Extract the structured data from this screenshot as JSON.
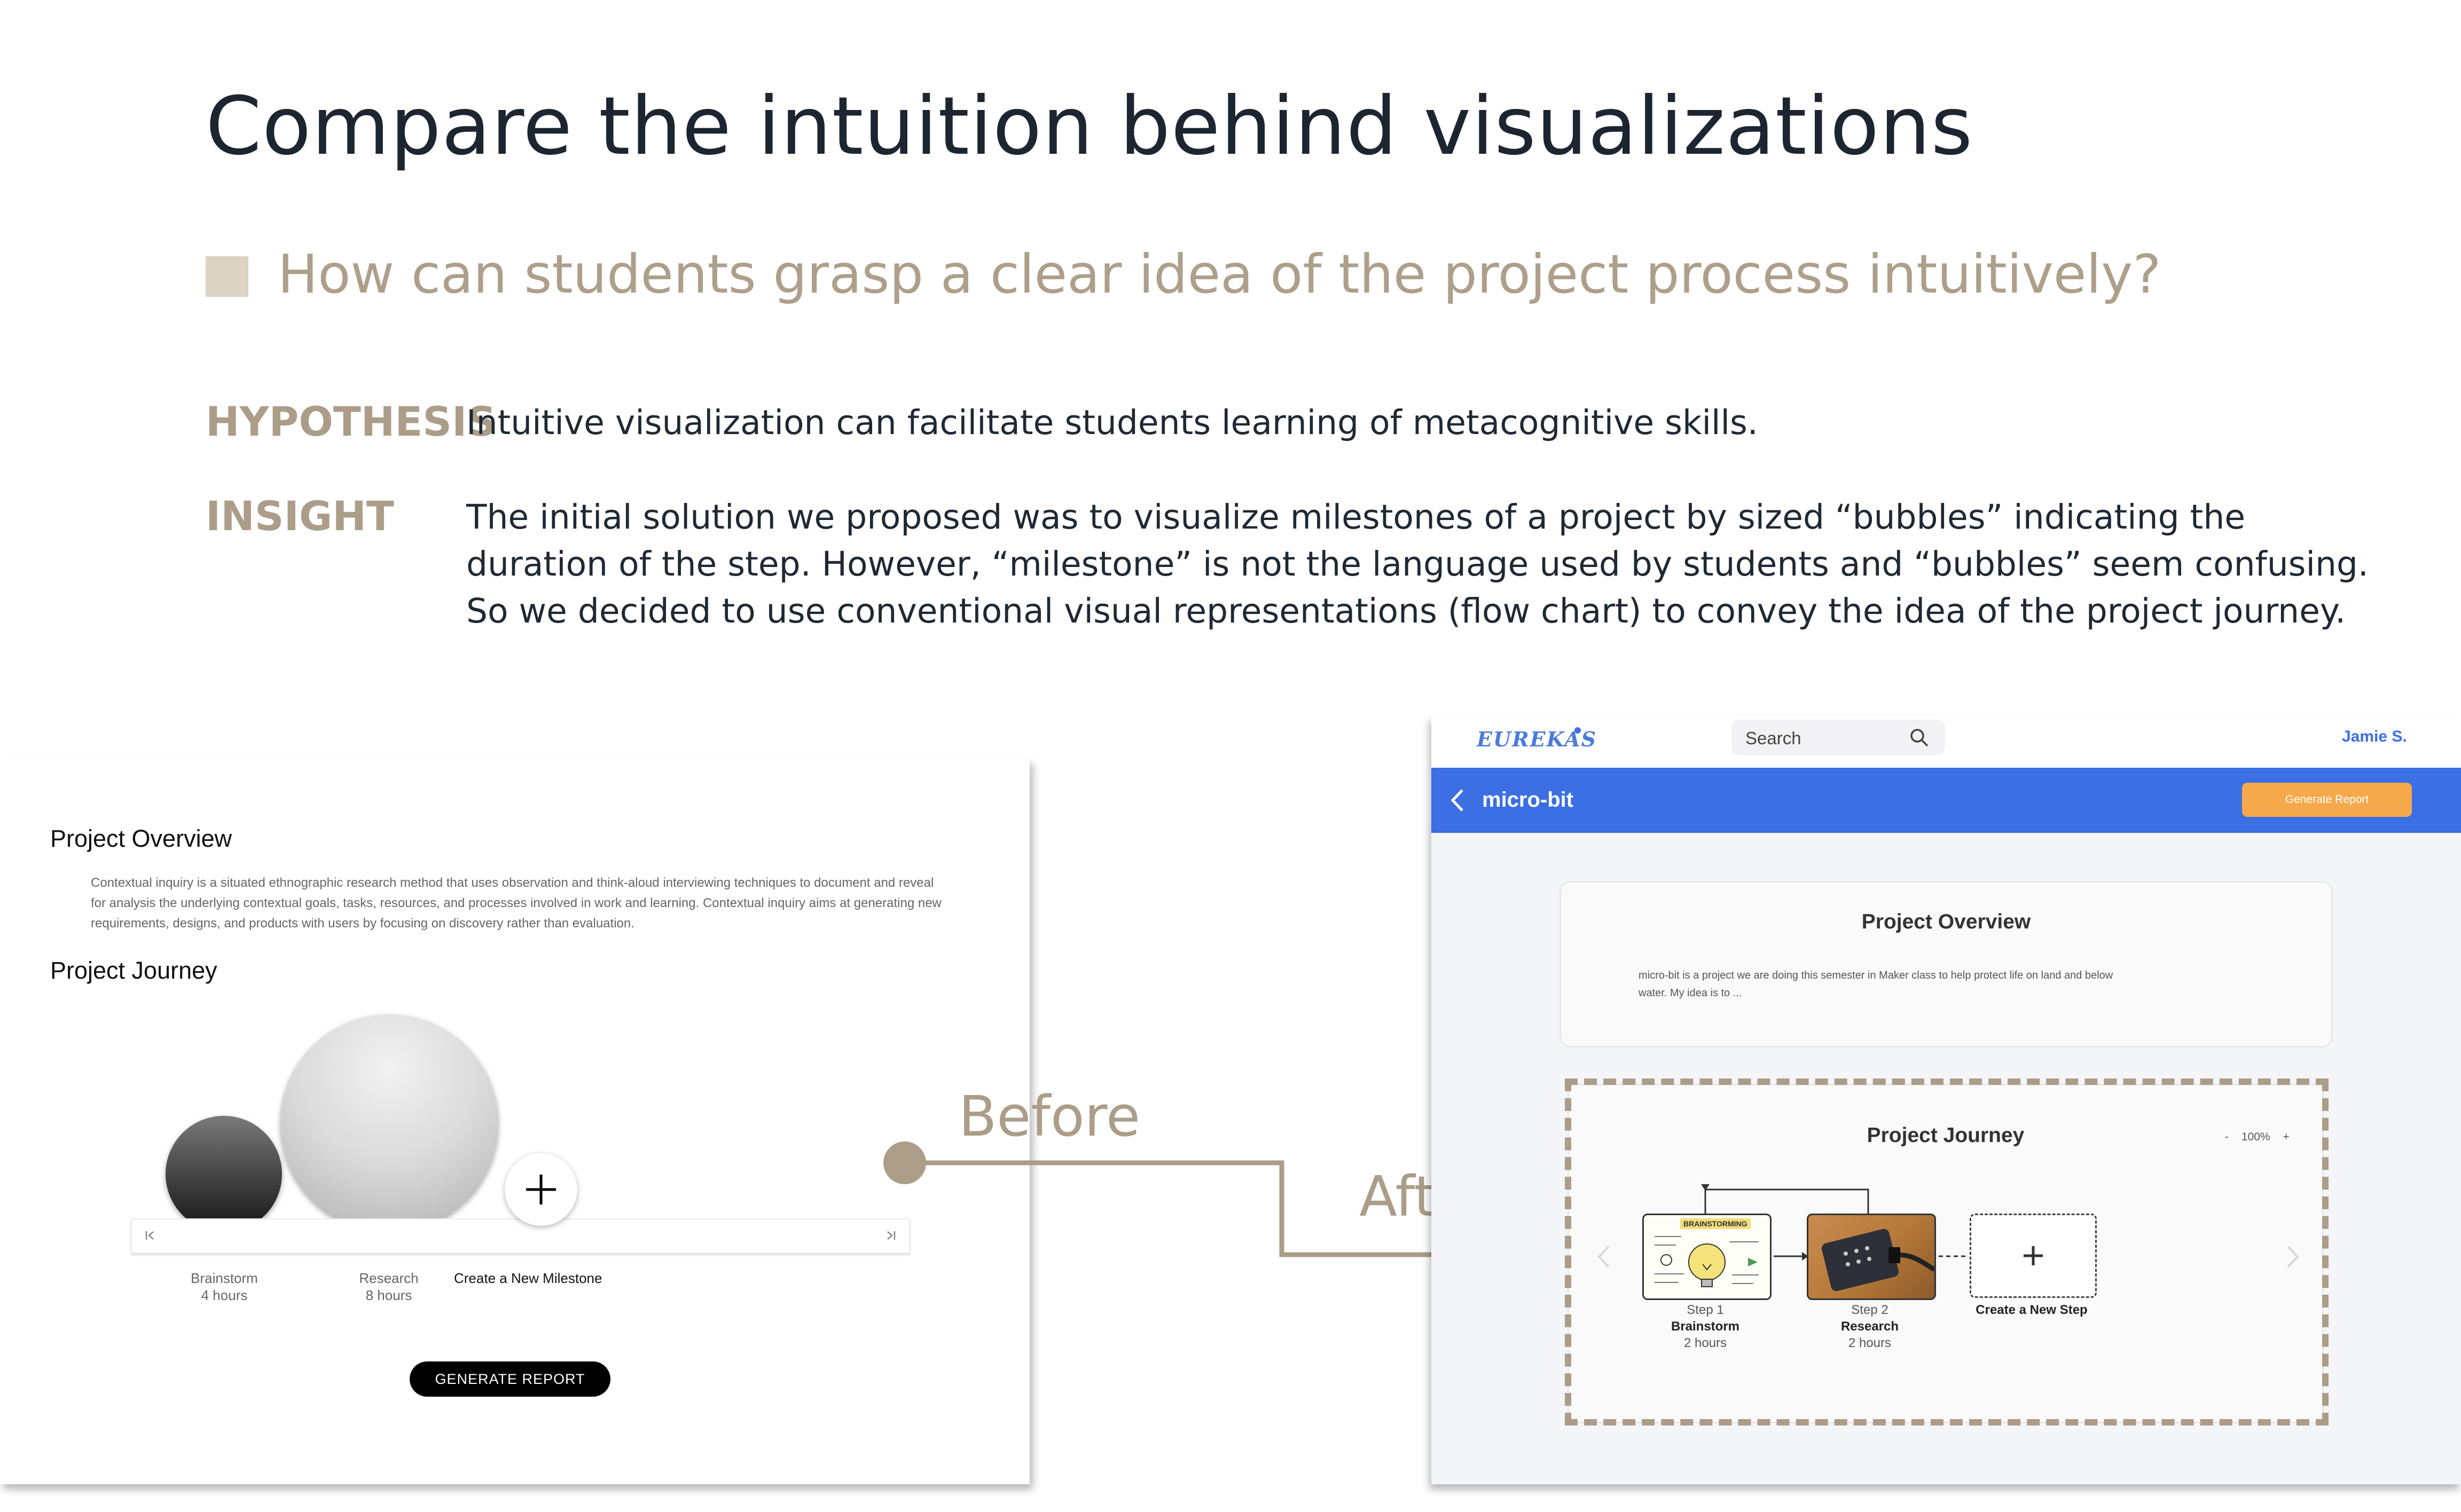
{
  "slide": {
    "title": "Compare the intuition behind visualizations",
    "question": "How can students grasp a clear idea of the project process intuitively?",
    "hypothesis_label": "HYPOTHESIS",
    "hypothesis_text": "Intuitive visualization can facilitate students learning of metacognitive skills.",
    "insight_label": "INSIGHT",
    "insight_lines": [
      "The initial solution we proposed was to visualize milestones of a project by sized “bubbles” indicating the",
      "duration of the step. However, “milestone” is not the language used by students and “bubbles” seem confusing.",
      "So we decided to use conventional visual representations (flow chart) to convey the idea of the project journey."
    ],
    "before_label": "Before",
    "after_label": "After",
    "accent_color": "#ab9d88"
  },
  "before": {
    "overview_heading": "Project Overview",
    "overview_text": "Contextual inquiry is a situated ethnographic research method that uses observation and think-aloud interviewing techniques to document and reveal for analysis the underlying contextual goals, tasks, resources, and processes involved in work and learning. Contextual inquiry aims at generating new requirements, designs, and products with users by focusing on discovery rather than evaluation.",
    "journey_heading": "Project Journey",
    "milestones": [
      {
        "name": "Brainstorm",
        "duration": "4 hours"
      },
      {
        "name": "Research",
        "duration": "8 hours"
      }
    ],
    "add_label": "Create a New Milestone",
    "first_icon": "skip-first-icon",
    "last_icon": "skip-last-icon",
    "generate_button": "GENERATE REPORT"
  },
  "after": {
    "logo": "EUREKAS",
    "search_placeholder": "Search",
    "user_name": "Jamie S.",
    "project_title": "micro-bit",
    "generate_button": "Generate Report",
    "brand_color": "#3b6fe3",
    "button_color": "#f5a94a",
    "overview_heading": "Project Overview",
    "overview_lines": [
      "micro-bit is a project we are doing this semester in Maker class to help protect life on land and below",
      "water. My idea is to ..."
    ],
    "journey_heading": "Project Journey",
    "zoom_minus": "-",
    "zoom_level": "100%",
    "zoom_plus": "+",
    "steps": [
      {
        "step": "Step 1",
        "name": "Brainstorm",
        "duration": "2 hours",
        "image_text": "BRAINSTORMING"
      },
      {
        "step": "Step 2",
        "name": "Research",
        "duration": "2 hours"
      }
    ],
    "add_step_label": "Create a New Step"
  }
}
